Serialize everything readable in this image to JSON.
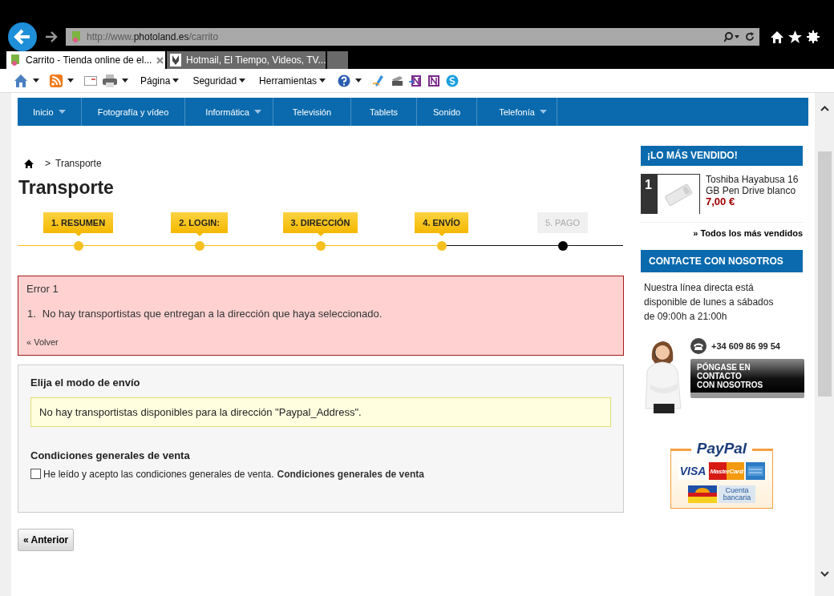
{
  "browser": {
    "url": {
      "prefix": "http://www.",
      "domain": "photoland.es",
      "path": "/carrito"
    },
    "tabs": [
      {
        "title": "Carrito - Tienda online de el...",
        "selected": true
      },
      {
        "title": "Hotmail, El Tiempo, Videos, TV...",
        "selected": false
      }
    ],
    "command_bar": [
      "Página",
      "Seguridad",
      "Herramientas"
    ]
  },
  "nav": [
    {
      "label": "Inicio",
      "has_menu": true
    },
    {
      "label": "Fotografía y vídeo",
      "has_menu": false
    },
    {
      "label": "Informática",
      "has_menu": true
    },
    {
      "label": "Televisión",
      "has_menu": false
    },
    {
      "label": "Tablets",
      "has_menu": false
    },
    {
      "label": "Sonido",
      "has_menu": false
    },
    {
      "label": "Telefonía",
      "has_menu": true
    }
  ],
  "breadcrumb": {
    "separator": ">",
    "current": "Transporte"
  },
  "title": "Transporte",
  "steps": [
    {
      "label": "1. RESUMEN",
      "done": true
    },
    {
      "label": "2. LOGIN:",
      "done": true
    },
    {
      "label": "3. DIRECCIÓN",
      "done": true
    },
    {
      "label": "4. ENVÍO",
      "done": true
    },
    {
      "label": "5. PAGO",
      "done": false
    }
  ],
  "error": {
    "title": "Error 1",
    "items": [
      {
        "number": "1.",
        "text": "No hay transportistas que entregan a la dirección que haya seleccionado."
      }
    ],
    "back_link": "« Volver"
  },
  "shipping": {
    "heading": "Elija el modo de envío",
    "notice": "No hay transportistas disponibles para la dirección \"Paypal_Address\".",
    "terms_heading": "Condiciones generales de venta",
    "terms_checkbox": {
      "checked": false,
      "label": "He leído y acepto las condiciones generales de venta.",
      "link": "Condiciones generales de venta"
    }
  },
  "previous_button": "« Anterior",
  "sidebar": {
    "bestsellers": {
      "heading": "¡LO MÁS VENDIDO!",
      "items": [
        {
          "rank": "1",
          "name": "Toshiba Hayabusa 16 GB Pen Drive blanco",
          "price": "7,00 €"
        }
      ],
      "all_link": "» Todos los más vendidos"
    },
    "contact": {
      "heading": "CONTACTE CON NOSOTROS",
      "text": "Nuestra línea directa está disponible de lunes a sábados de 09:00h a 21:00h",
      "phone": "+34 609 86 99 54",
      "button_lines": [
        "PÓNGASE EN",
        "CONTACTO",
        "CON NOSOTROS"
      ]
    },
    "payment": {
      "brand": "PayPal",
      "logos": [
        {
          "kind": "visa",
          "label": "VISA"
        },
        {
          "kind": "mastercard",
          "label": "MasterCard"
        },
        {
          "kind": "amex"
        },
        {
          "kind": "aurora"
        },
        {
          "kind": "bank",
          "label": "Cuenta bancaria"
        }
      ]
    }
  }
}
